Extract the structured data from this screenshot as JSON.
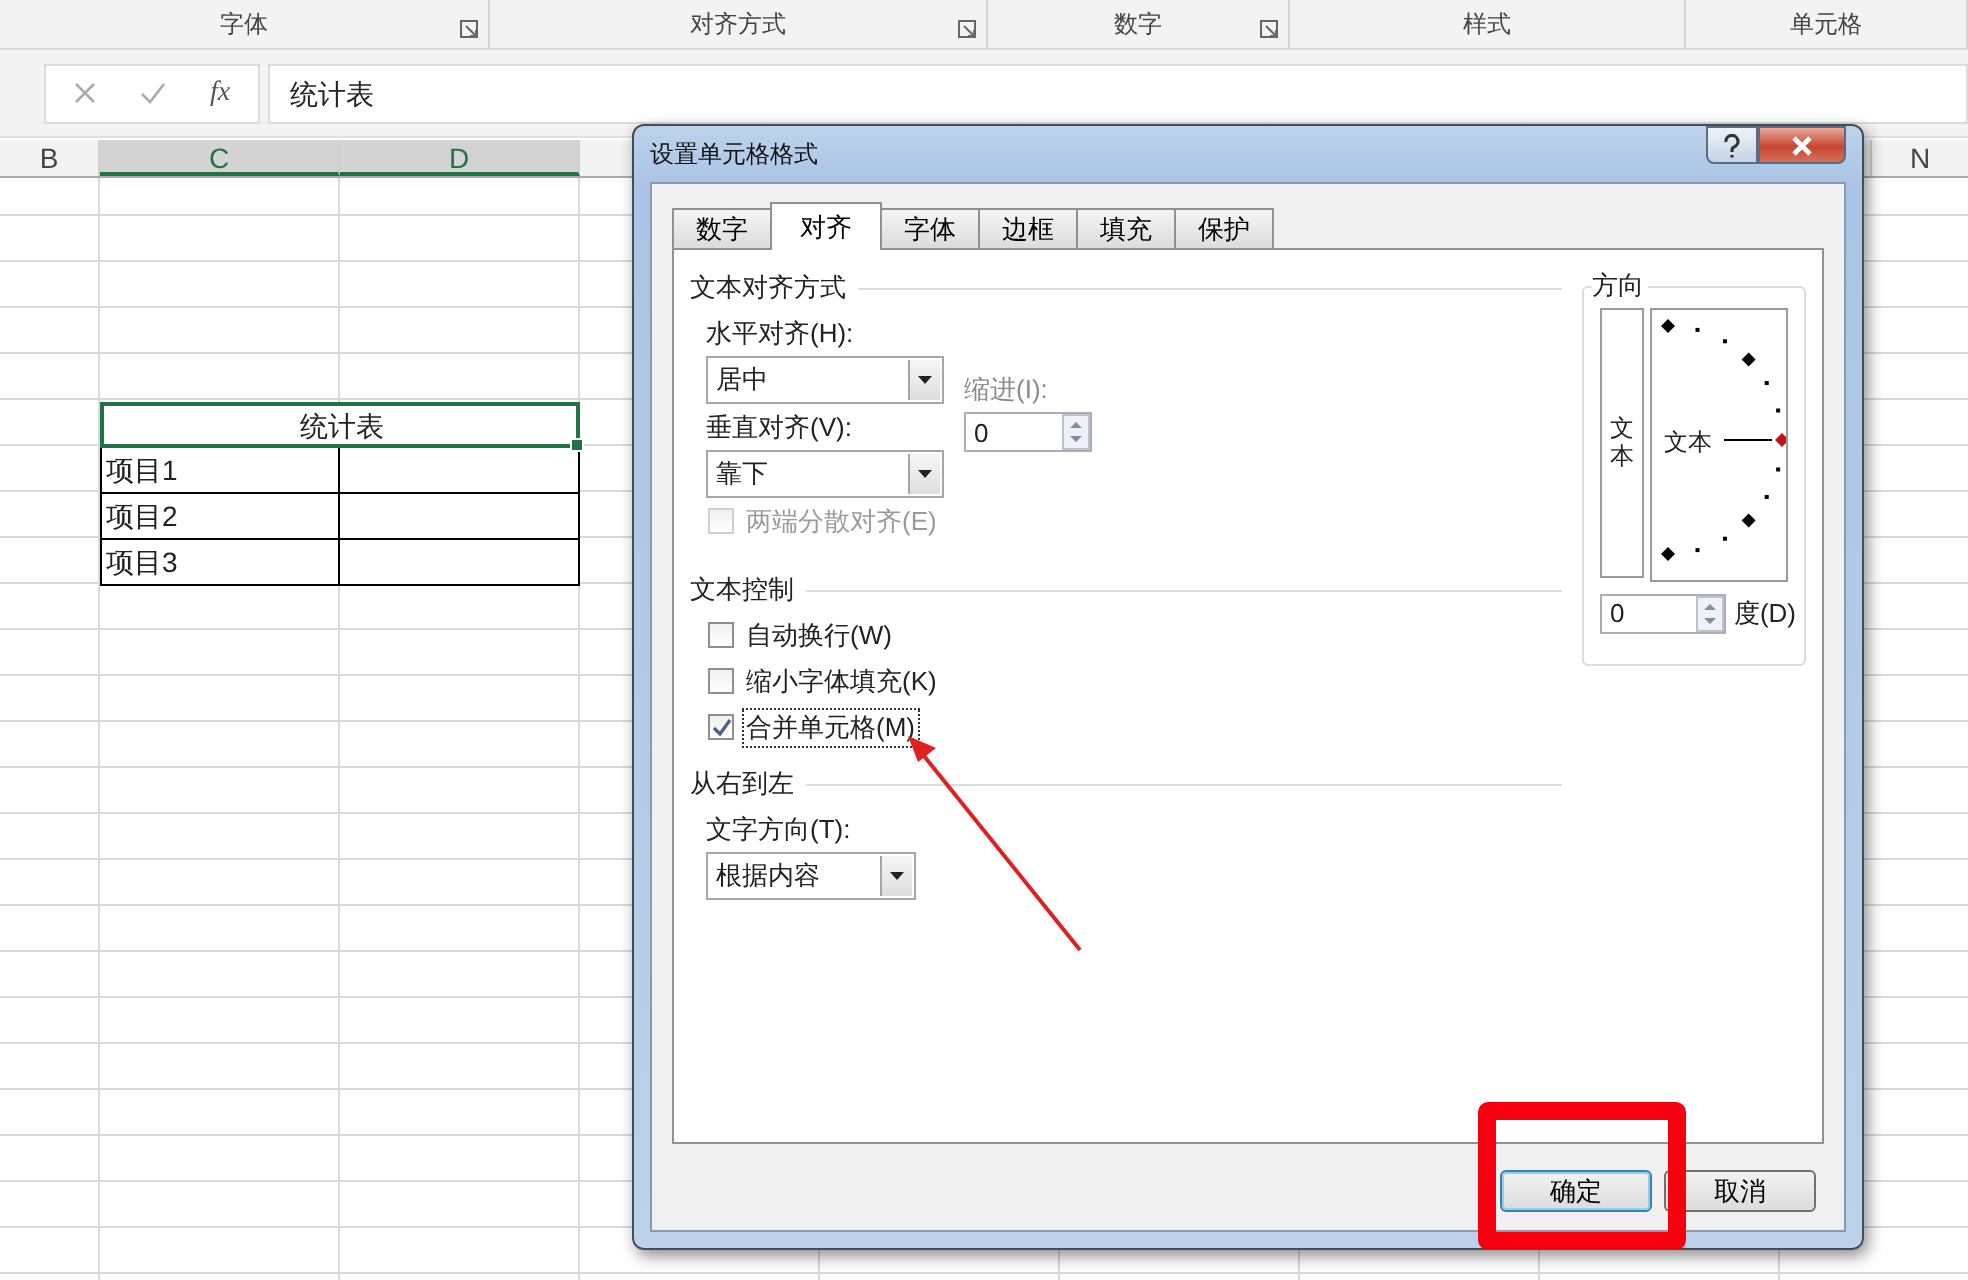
{
  "ribbon_groups": [
    {
      "label": "字体",
      "launcher": true
    },
    {
      "label": "对齐方式",
      "launcher": true
    },
    {
      "label": "数字",
      "launcher": true
    },
    {
      "label": "样式",
      "launcher": false
    },
    {
      "label": "单元格",
      "launcher": false
    }
  ],
  "formula_bar": {
    "function_label": "fx",
    "value": "统计表"
  },
  "sheet": {
    "columns": [
      {
        "label": "B",
        "selected": false
      },
      {
        "label": "C",
        "selected": true
      },
      {
        "label": "D",
        "selected": true
      },
      {
        "label": "N",
        "selected": false
      }
    ],
    "table": {
      "title": "统计表",
      "title_selected": true,
      "rows": [
        "项目1",
        "项目2",
        "项目3"
      ]
    }
  },
  "dialog": {
    "title": "设置单元格格式",
    "tabs": [
      {
        "label": "数字",
        "selected": false
      },
      {
        "label": "对齐",
        "selected": true
      },
      {
        "label": "字体",
        "selected": false
      },
      {
        "label": "边框",
        "selected": false
      },
      {
        "label": "填充",
        "selected": false
      },
      {
        "label": "保护",
        "selected": false
      }
    ],
    "text_alignment": {
      "heading": "文本对齐方式",
      "horizontal_label": "水平对齐(H):",
      "horizontal_value": "居中",
      "indent_label": "缩进(I):",
      "indent_value": "0",
      "vertical_label": "垂直对齐(V):",
      "vertical_value": "靠下",
      "distributed": {
        "label": "两端分散对齐(E)",
        "checked": false,
        "disabled": true
      }
    },
    "text_control": {
      "heading": "文本控制",
      "options": [
        {
          "label": "自动换行(W)",
          "checked": false,
          "focused": false
        },
        {
          "label": "缩小字体填充(K)",
          "checked": false,
          "focused": false
        },
        {
          "label": "合并单元格(M)",
          "checked": true,
          "focused": true
        }
      ]
    },
    "right_to_left": {
      "heading": "从右到左",
      "direction_label": "文字方向(T):",
      "direction_value": "根据内容"
    },
    "orientation": {
      "heading": "方向",
      "vertical_text": "文本",
      "dial_text": "文本",
      "degrees_value": "0",
      "degrees_label": "度(D)"
    },
    "buttons": [
      {
        "label": "确定",
        "default": true
      },
      {
        "label": "取消",
        "default": false
      }
    ]
  },
  "annotations": {
    "arrow": true,
    "highlight_frame": true
  }
}
